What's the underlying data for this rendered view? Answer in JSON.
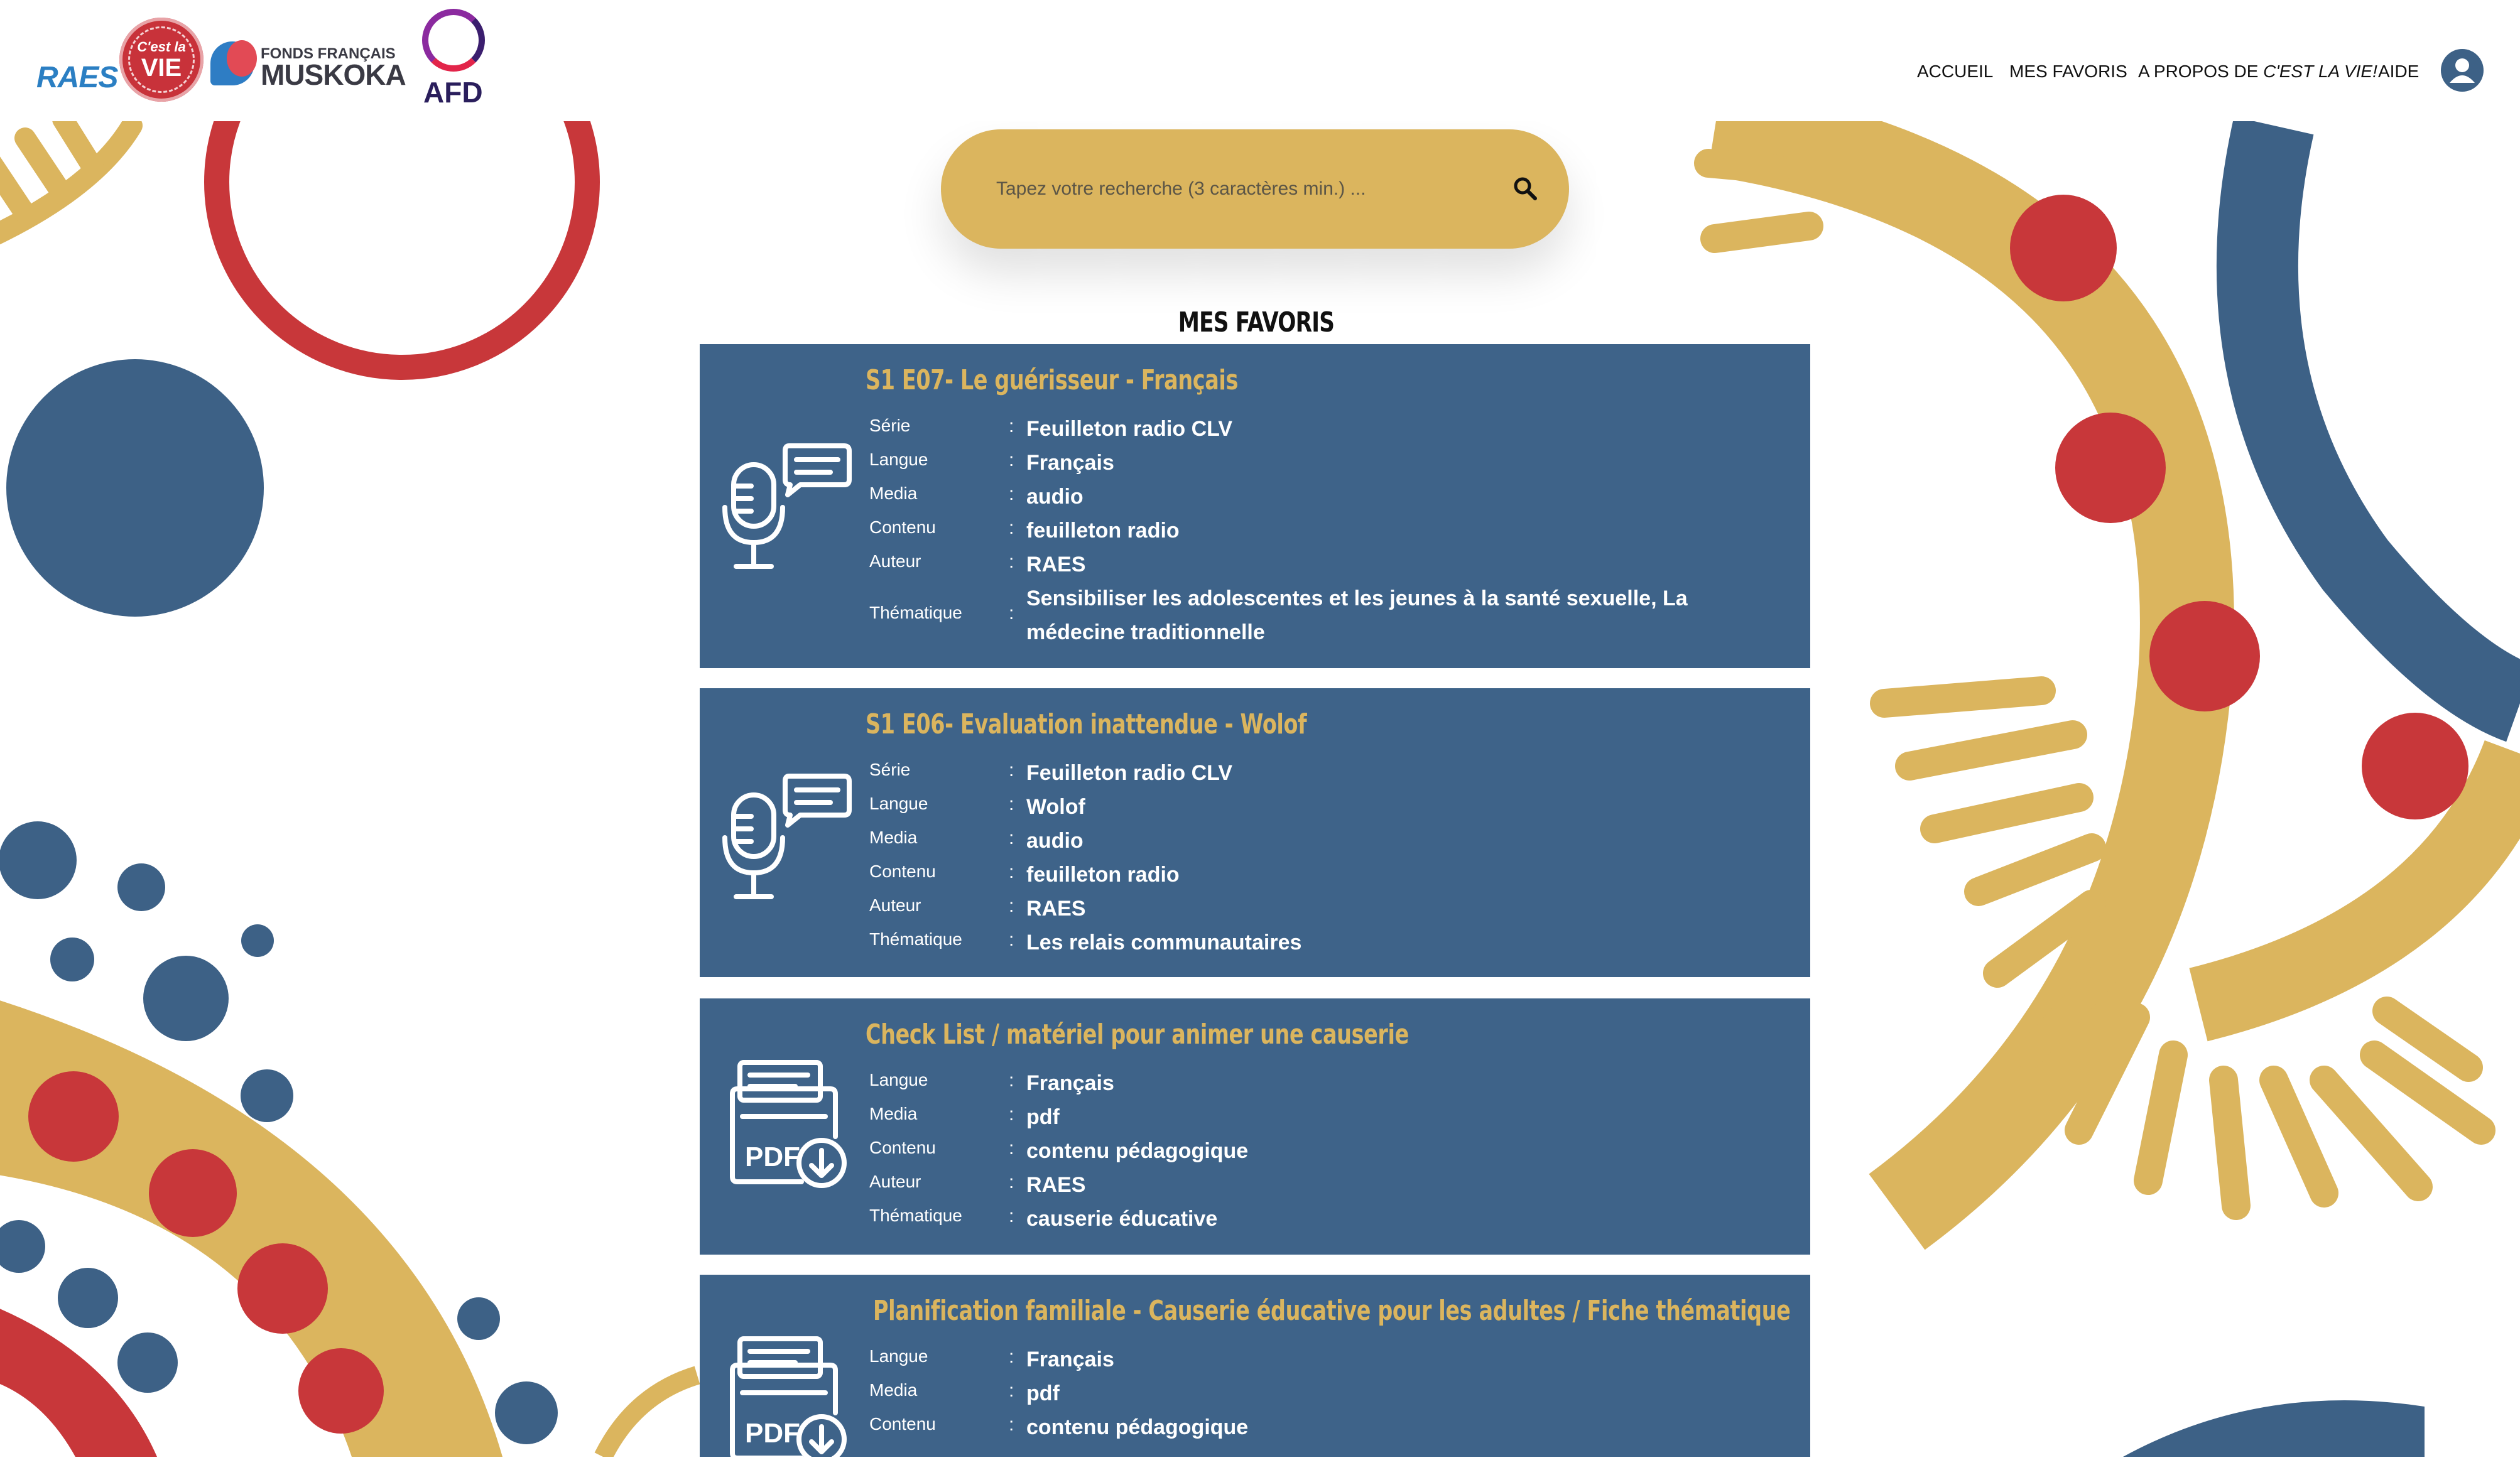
{
  "header": {
    "logos": {
      "raes": "RAES",
      "clv_line1": "C'est la",
      "clv_line2": "VIE",
      "muskoka_line1": "FONDS FRANÇAIS",
      "muskoka_line2": "MUSKOKA",
      "afd": "AFD"
    },
    "nav": {
      "home": "ACCUEIL",
      "favorites": "MES FAVORIS",
      "about_prefix": "A PROPOS DE ",
      "about_em": "C'EST LA VIE!",
      "help": "AIDE"
    },
    "user_icon": "user-circle-icon"
  },
  "search": {
    "placeholder": "Tapez votre recherche (3 caractères min.) ...",
    "icon": "search-icon"
  },
  "page_title": "MES FAVORIS",
  "cards": [
    {
      "title": "S1 E07- Le guérisseur - Français",
      "icon": "microphone-chat-icon",
      "rows": [
        {
          "label": "Série",
          "sep": ":",
          "value": "Feuilleton radio CLV"
        },
        {
          "label": "Langue",
          "sep": ":",
          "value": "Français"
        },
        {
          "label": "Media",
          "sep": ":",
          "value": "audio"
        },
        {
          "label": "Contenu",
          "sep": ":",
          "value": "feuilleton radio"
        },
        {
          "label": "Auteur",
          "sep": ":",
          "value": "RAES"
        },
        {
          "label": "Thématique",
          "sep": ":",
          "value": "Sensibiliser les adolescentes et les jeunes à la santé sexuelle, La médecine traditionnelle"
        }
      ]
    },
    {
      "title": "S1 E06- Evaluation inattendue - Wolof",
      "icon": "microphone-chat-icon",
      "rows": [
        {
          "label": "Série",
          "sep": ":",
          "value": "Feuilleton radio CLV"
        },
        {
          "label": "Langue",
          "sep": ":",
          "value": "Wolof"
        },
        {
          "label": "Media",
          "sep": ":",
          "value": "audio"
        },
        {
          "label": "Contenu",
          "sep": ":",
          "value": "feuilleton radio"
        },
        {
          "label": "Auteur",
          "sep": ":",
          "value": "RAES"
        },
        {
          "label": "Thématique",
          "sep": ":",
          "value": "Les relais communautaires"
        }
      ]
    },
    {
      "title": "Check List / matériel pour animer une causerie",
      "icon": "pdf-download-icon",
      "rows": [
        {
          "label": "Langue",
          "sep": ":",
          "value": "Français"
        },
        {
          "label": "Media",
          "sep": ":",
          "value": "pdf"
        },
        {
          "label": "Contenu",
          "sep": ":",
          "value": "contenu pédagogique"
        },
        {
          "label": "Auteur",
          "sep": ":",
          "value": "RAES"
        },
        {
          "label": "Thématique",
          "sep": ":",
          "value": "causerie éducative"
        }
      ]
    },
    {
      "title": "Planification familiale - Causerie éducative pour les adultes / Fiche thématique",
      "icon": "pdf-download-icon",
      "rows": [
        {
          "label": "Langue",
          "sep": ":",
          "value": "Français"
        },
        {
          "label": "Media",
          "sep": ":",
          "value": "pdf"
        },
        {
          "label": "Contenu",
          "sep": ":",
          "value": "contenu pédagogique"
        }
      ]
    }
  ],
  "colors": {
    "card_bg": "#3e6389",
    "gold": "#dbb55e",
    "red": "#c8373a",
    "blue": "#3d6186"
  }
}
